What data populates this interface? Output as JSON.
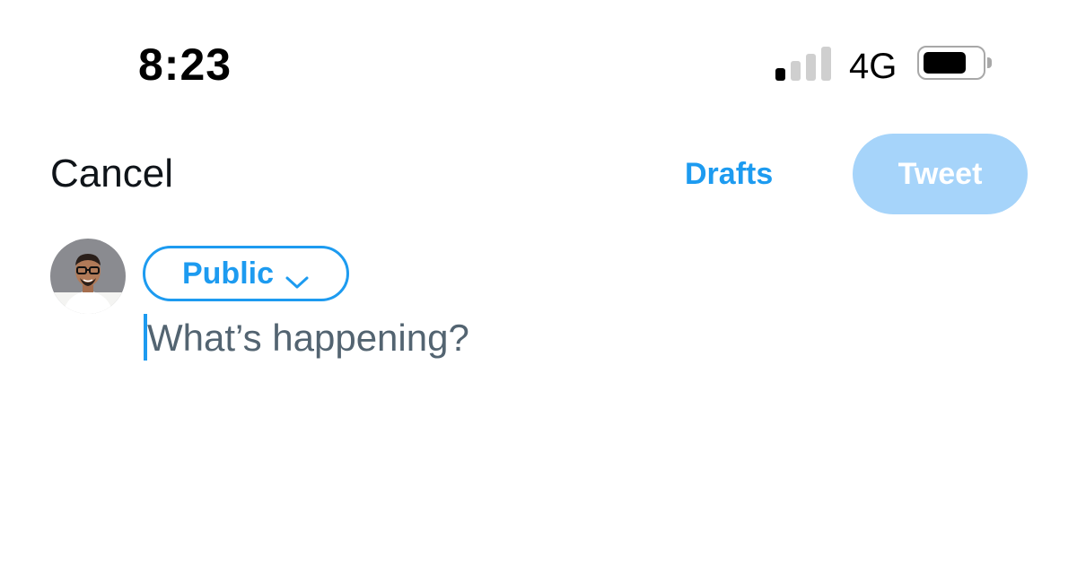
{
  "status_bar": {
    "time": "8:23",
    "network": "4G",
    "signal_bars_active": 1,
    "signal_bars_total": 4,
    "battery_level": 0.75
  },
  "header": {
    "cancel_label": "Cancel",
    "drafts_label": "Drafts",
    "tweet_label": "Tweet"
  },
  "composer": {
    "audience_label": "Public",
    "placeholder": "What’s happening?"
  },
  "icons": {
    "audience_chevron": "chevron-down-icon",
    "signal": "cellular-signal-icon",
    "battery": "battery-icon"
  },
  "colors": {
    "accent": "#1d9bf0",
    "tweet_button_disabled": "#a6d4fa",
    "placeholder_text": "#536471"
  }
}
